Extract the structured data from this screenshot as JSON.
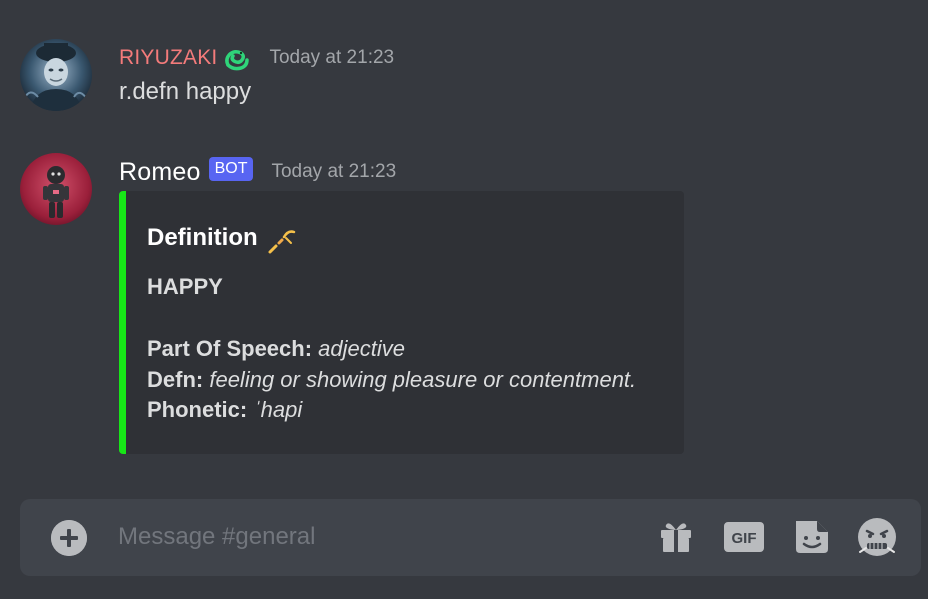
{
  "messages": [
    {
      "author": "RIYUZAKI",
      "author_color": "#f47b7b",
      "badge_icon": "snake-icon",
      "timestamp": "Today at 21:23",
      "content": "r.defn happy"
    },
    {
      "author": "Romeo",
      "author_color": "#ffffff",
      "bot_tag": "BOT",
      "timestamp": "Today at 21:23",
      "embed": {
        "accent_color": "#17e617",
        "title": "Definition",
        "title_icon": "pencil-icon",
        "word": "HAPPY",
        "fields": {
          "part_of_speech": {
            "label": "Part Of Speech:",
            "value": "adjective"
          },
          "defn": {
            "label": "Defn:",
            "value": "feeling or showing pleasure or contentment."
          },
          "phonetic": {
            "label": "Phonetic:",
            "value": "ˈhapi"
          }
        }
      }
    }
  ],
  "composer": {
    "placeholder": "Message #general",
    "buttons": {
      "add": "plus-circle-icon",
      "gift": "gift-icon",
      "gif": "GIF",
      "sticker": "sticker-icon",
      "emoji": "emoji-icon"
    }
  },
  "colors": {
    "background": "#36393f",
    "embed_bg": "#2f3136",
    "composer_bg": "#40444b",
    "bot_tag": "#5865f2"
  }
}
